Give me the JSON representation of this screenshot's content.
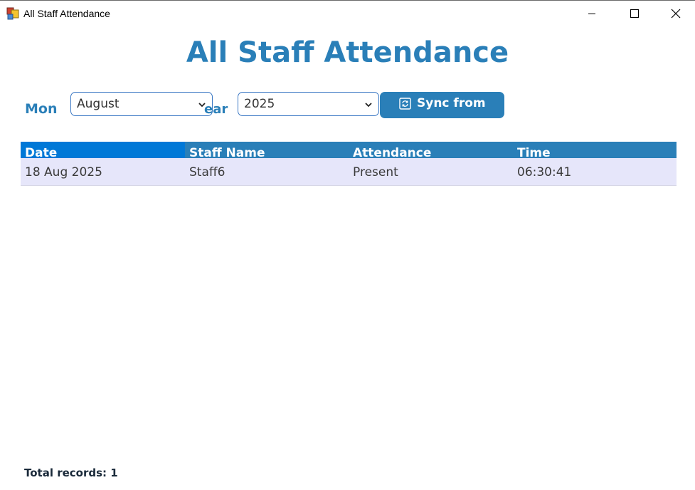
{
  "window": {
    "title": "All Staff Attendance",
    "icons": {
      "app": "app-icon",
      "minimize": "minimize-icon",
      "maximize": "maximize-icon",
      "close": "close-icon"
    }
  },
  "header": {
    "title": "All Staff Attendance"
  },
  "filters": {
    "month_label": "Mon",
    "month_value": "August",
    "year_label": "ear",
    "year_value": "2025",
    "sync_label": "Sync from",
    "sync_icon": "sync-icon"
  },
  "table": {
    "columns": [
      "Date",
      "Staff Name",
      "Attendance",
      "Time"
    ],
    "rows": [
      [
        "18 Aug 2025",
        "Staff6",
        "Present",
        "06:30:41"
      ]
    ]
  },
  "footer": {
    "total_records": "Total records: 1"
  },
  "colors": {
    "accent": "#2a7fb8",
    "selected_header": "#0078d7",
    "row_background": "#e6e6fa"
  }
}
